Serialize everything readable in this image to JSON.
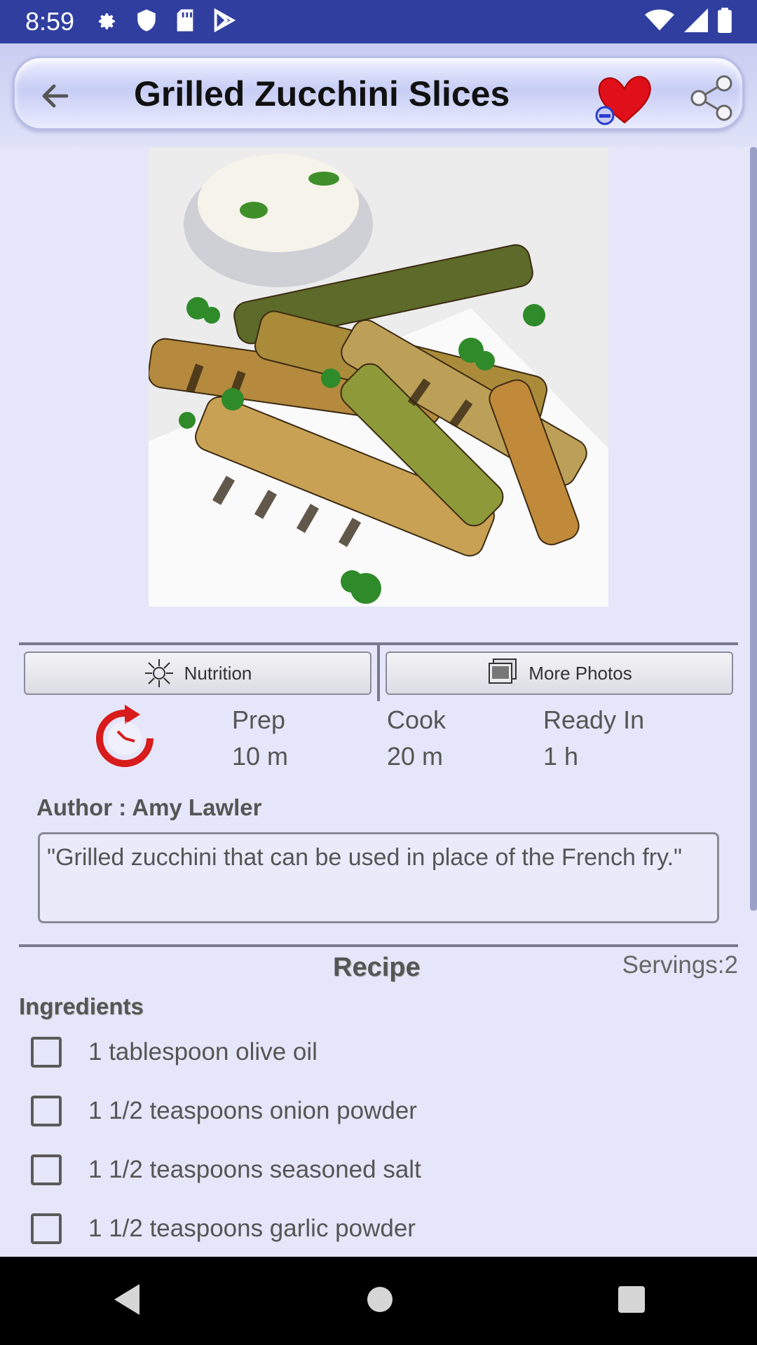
{
  "status_bar": {
    "time": "8:59",
    "left_icons": [
      "settings-gear-icon",
      "shield-icon",
      "sd-card-icon",
      "play-store-icon"
    ],
    "right_icons": [
      "wifi-icon",
      "signal-icon",
      "battery-icon"
    ]
  },
  "toolbar": {
    "title": "Grilled Zucchini Slices",
    "back_icon": "arrow-left-icon",
    "favorite_icon": "heart-remove-icon",
    "share_icon": "share-icon"
  },
  "buttons": {
    "nutrition": "Nutrition",
    "more_photos": "More Photos"
  },
  "times": {
    "prep_label": "Prep",
    "prep_value": "10 m",
    "cook_label": "Cook",
    "cook_value": "20 m",
    "ready_label": "Ready In",
    "ready_value": "1 h"
  },
  "author": "Author : Amy Lawler",
  "description": "\"Grilled zucchini that can be used in place of the French fry.\"",
  "recipe": {
    "heading": "Recipe",
    "servings": "Servings:2",
    "ingredients_heading": "Ingredients",
    "ingredients": [
      "1 tablespoon olive oil",
      "1 1/2 teaspoons onion powder",
      "1 1/2 teaspoons seasoned salt",
      "1 1/2 teaspoons garlic powder"
    ]
  },
  "colors": {
    "status_bar": "#303f9f",
    "background": "#e6e6fa",
    "heart": "#e0101a",
    "timer": "#d81b1b"
  }
}
